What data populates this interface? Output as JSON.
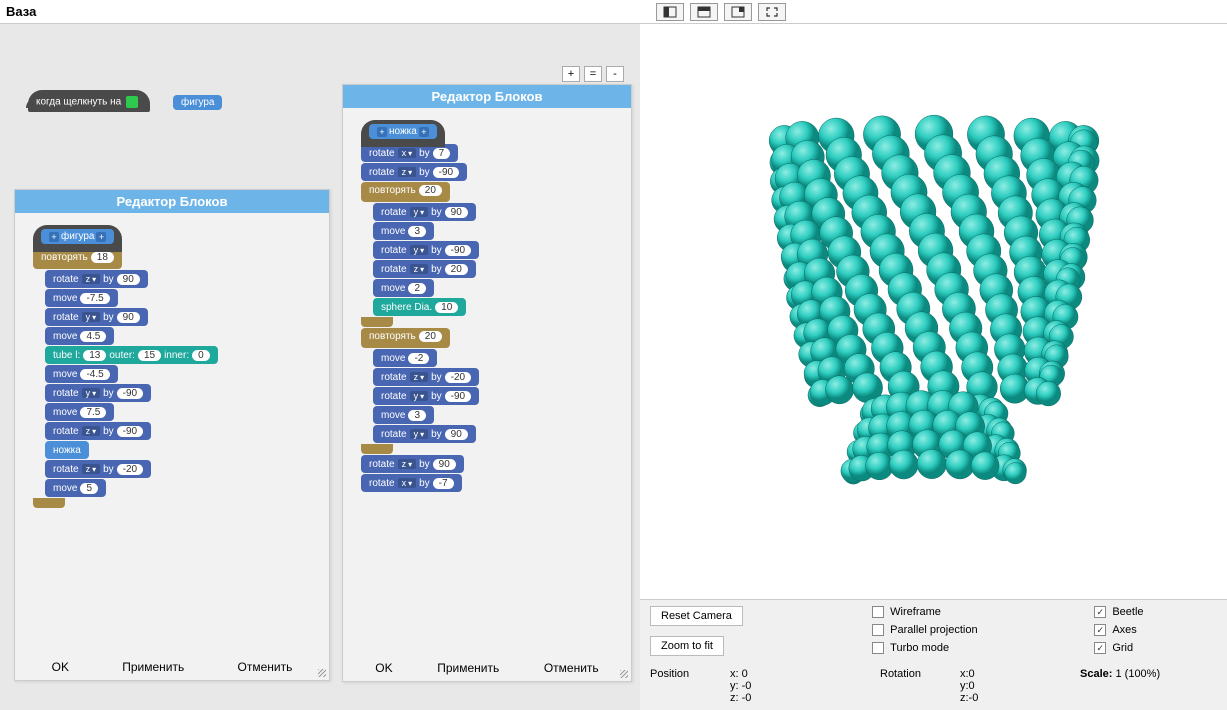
{
  "title": "Ваза",
  "zoom_buttons": [
    "+",
    "=",
    "-"
  ],
  "hat": {
    "text": "когда щелкнуть на",
    "chip": "фигура"
  },
  "editor1": {
    "header": "Редактор Блоков",
    "define": "фигура",
    "repeat_label": "повторять",
    "repeat_count": "18",
    "blocks": [
      {
        "t": "rotate",
        "axis": "z",
        "by": "by",
        "val": "90"
      },
      {
        "t": "move",
        "val": "-7.5"
      },
      {
        "t": "rotate",
        "axis": "y",
        "by": "by",
        "val": "90"
      },
      {
        "t": "move",
        "val": "4.5"
      },
      {
        "t": "tube",
        "l": "13",
        "outer": "15",
        "inner": "0"
      },
      {
        "t": "move",
        "val": "-4.5"
      },
      {
        "t": "rotate",
        "axis": "y",
        "by": "by",
        "val": "-90"
      },
      {
        "t": "move",
        "val": "7.5"
      },
      {
        "t": "rotate",
        "axis": "z",
        "by": "by",
        "val": "-90"
      },
      {
        "t": "call",
        "name": "ножка"
      },
      {
        "t": "rotate",
        "axis": "z",
        "by": "by",
        "val": "-20"
      },
      {
        "t": "move",
        "val": "5"
      }
    ],
    "ok": "OK",
    "apply": "Применить",
    "cancel": "Отменить"
  },
  "editor2": {
    "header": "Редактор Блоков",
    "define": "ножка",
    "pre": [
      {
        "t": "rotate",
        "axis": "x",
        "by": "by",
        "val": "7"
      },
      {
        "t": "rotate",
        "axis": "z",
        "by": "by",
        "val": "-90"
      }
    ],
    "repeat1_label": "повторять",
    "repeat1_count": "20",
    "repeat1_blocks": [
      {
        "t": "rotate",
        "axis": "y",
        "by": "by",
        "val": "90"
      },
      {
        "t": "move",
        "val": "3"
      },
      {
        "t": "rotate",
        "axis": "y",
        "by": "by",
        "val": "-90"
      },
      {
        "t": "rotate",
        "axis": "z",
        "by": "by",
        "val": "20"
      },
      {
        "t": "move",
        "val": "2"
      },
      {
        "t": "sphere",
        "val": "10"
      }
    ],
    "repeat2_label": "повторять",
    "repeat2_count": "20",
    "repeat2_blocks": [
      {
        "t": "move",
        "val": "-2"
      },
      {
        "t": "rotate",
        "axis": "z",
        "by": "by",
        "val": "-20"
      },
      {
        "t": "rotate",
        "axis": "y",
        "by": "by",
        "val": "-90"
      },
      {
        "t": "move",
        "val": "3"
      },
      {
        "t": "rotate",
        "axis": "y",
        "by": "by",
        "val": "90"
      }
    ],
    "post": [
      {
        "t": "rotate",
        "axis": "z",
        "by": "by",
        "val": "90"
      },
      {
        "t": "rotate",
        "axis": "x",
        "by": "by",
        "val": "-7"
      }
    ],
    "ok": "OK",
    "apply": "Применить",
    "cancel": "Отменить"
  },
  "labels": {
    "rotate": "rotate",
    "move": "move",
    "by": "by",
    "tube_l": "tube l:",
    "outer": "outer:",
    "inner": "inner:",
    "sphere": "sphere Dia."
  },
  "controls": {
    "reset": "Reset Camera",
    "zoomfit": "Zoom to fit",
    "wireframe": "Wireframe",
    "parallel": "Parallel projection",
    "turbo": "Turbo mode",
    "beetle": "Beetle",
    "axes": "Axes",
    "grid": "Grid",
    "position": "Position",
    "pos_x": "x: 0",
    "pos_y": "y: -0",
    "pos_z": "z: -0",
    "rotation": "Rotation",
    "rot_x": "x:0",
    "rot_y": "y:0",
    "rot_z": "z:-0",
    "scale_lbl": "Scale:",
    "scale_val": "1 (100%)"
  }
}
